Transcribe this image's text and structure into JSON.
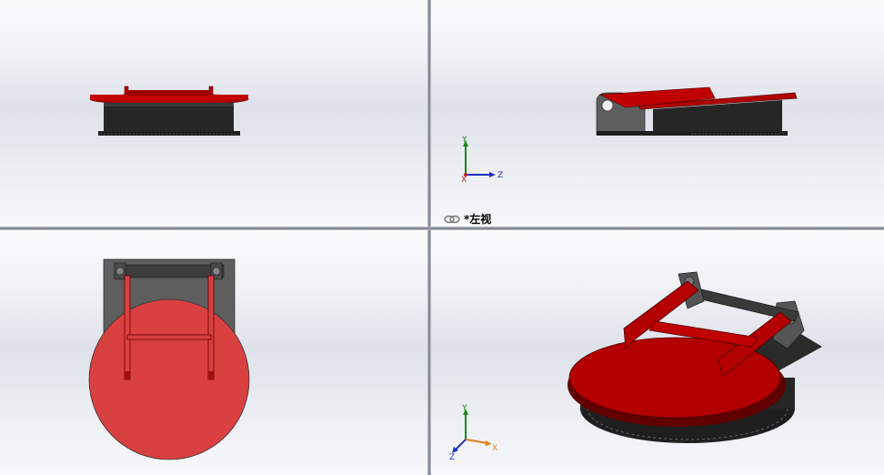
{
  "viewports": {
    "top_left": {
      "name": "front-view"
    },
    "top_right": {
      "name": "left-view",
      "label": "*左视"
    },
    "bottom_left": {
      "name": "top-view"
    },
    "bottom_right": {
      "name": "isometric-view"
    }
  },
  "triad": {
    "x": "X",
    "y": "Y",
    "z": "Z"
  },
  "colors": {
    "lid_red": "#c00000",
    "lid_bright": "#e04040",
    "body_dark": "#2a2a2a",
    "bracket_gray": "#5e5e5e"
  }
}
